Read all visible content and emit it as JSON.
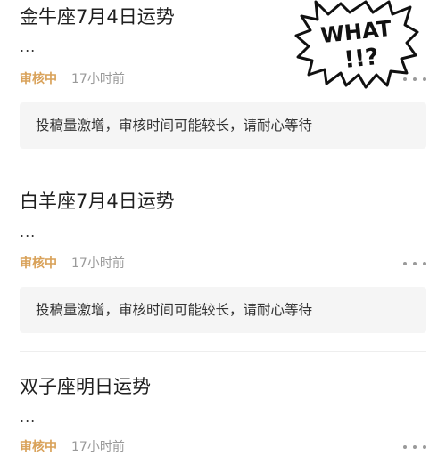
{
  "sticker": {
    "text_line1": "WHAT",
    "text_line2": "!!?"
  },
  "posts": [
    {
      "title": "金牛座7月4日运势",
      "excerpt": "...",
      "status": "审核中",
      "time": "17小时前",
      "notice": "投稿量激增，审核时间可能较长，请耐心等待"
    },
    {
      "title": "白羊座7月4日运势",
      "excerpt": "...",
      "status": "审核中",
      "time": "17小时前",
      "notice": "投稿量激增，审核时间可能较长，请耐心等待"
    },
    {
      "title": "双子座明日运势",
      "excerpt": "...",
      "status": "审核中",
      "time": "17小时前"
    }
  ],
  "colors": {
    "status": "#d9a25a",
    "meta": "#9a9a9a",
    "notice_bg": "#f5f5f5"
  }
}
